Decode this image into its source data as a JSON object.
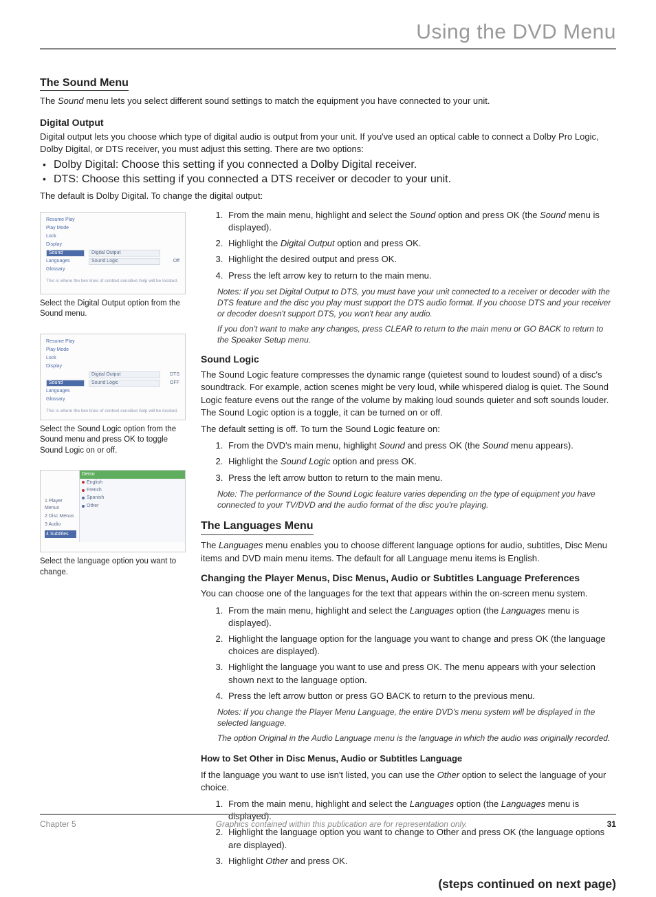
{
  "header": {
    "title": "Using the DVD Menu"
  },
  "sound_menu": {
    "heading": "The Sound Menu",
    "intro_pre": "The ",
    "intro_em": "Sound",
    "intro_post": " menu lets you select different sound settings to match the equipment you have connected to your unit."
  },
  "digital_output": {
    "heading": "Digital Output",
    "intro": "Digital output lets you choose which type of digital audio is output from your unit. If you've used an optical cable to connect a Dolby Pro Logic, Dolby Digital, or DTS receiver, you must adjust this setting. There are two options:",
    "bullets": [
      "Dolby Digital: Choose this setting if you connected a Dolby Digital receiver.",
      "DTS:  Choose this setting if you connected a DTS receiver or decoder to your unit."
    ],
    "default_line": "The default is Dolby Digital. To change the digital output:",
    "steps": [
      {
        "pre": "From the main menu, highlight and select the ",
        "em1": "Sound",
        "mid": " option and press OK (the ",
        "em2": "Sound",
        "post": " menu is displayed)."
      },
      {
        "pre": "Highlight the ",
        "em1": "Digital Output",
        "post": " option and press OK."
      },
      {
        "text": "Highlight the desired output and press OK."
      },
      {
        "text": "Press the left arrow key to return to the main menu."
      }
    ],
    "note1": "Notes: If you set Digital Output to DTS, you must have your unit connected to a receiver or decoder with the DTS feature and the disc you play must support the DTS audio format. If you choose DTS and your receiver or decoder doesn't support DTS, you won't hear any audio.",
    "note2": "If you don't want to make any changes, press CLEAR to return to the main menu or GO BACK to return to the Speaker Setup menu.",
    "caption": "Select the Digital Output option from the Sound menu.",
    "ss": {
      "items": [
        "Resume Play",
        "Play Mode",
        "Lock",
        "Display",
        "Sound",
        "Languages",
        "Glossary"
      ],
      "f1": "Digital Output",
      "f2": "Sound Logic",
      "v1": "",
      "v2": "Off",
      "help": "This is where the two lines of context sensitive help will be located."
    }
  },
  "sound_logic": {
    "heading": "Sound Logic",
    "intro": "The Sound Logic feature compresses the dynamic range (quietest sound to loudest sound) of a disc's soundtrack. For example, action scenes might be very loud, while whispered dialog is quiet. The Sound Logic feature evens out the range of the volume by making loud sounds quieter and soft sounds louder. The Sound Logic option is a toggle, it can be turned on or off.",
    "default_line": "The default setting is off. To turn the Sound Logic feature on:",
    "steps": [
      {
        "pre": "From the DVD's main menu, highlight ",
        "em1": "Sound",
        "mid": " and press OK (the ",
        "em2": "Sound",
        "post": " menu appears)."
      },
      {
        "pre": "Highlight the ",
        "em1": "Sound Logic",
        "post": " option and press OK."
      },
      {
        "text": "Press the left arrow button to return to the main menu."
      }
    ],
    "note1": "Note: The performance of the Sound Logic feature varies depending on the type of equipment you have connected to your TV/DVD and the audio format of the disc you're playing.",
    "caption": "Select the Sound Logic option from the Sound menu and press OK to toggle Sound Logic on or off.",
    "ss": {
      "f1": "Digital Output",
      "f2": "Sound Logic",
      "v1": "DTS",
      "v2": "OFF"
    }
  },
  "languages": {
    "heading": "The Languages Menu",
    "intro_pre": "The ",
    "intro_em": "Languages",
    "intro_post": " menu enables you to choose different language options for audio, subtitles, Disc Menu items and DVD main menu items. The default for all Language menu items is English.",
    "sub_heading": "Changing the Player Menus, Disc Menus, Audio or Subtitles Language Preferences",
    "choose_line": "You can choose one of the languages for the text that appears within the on-screen menu system.",
    "steps1": [
      {
        "pre": "From the main menu, highlight and select the ",
        "em1": "Languages",
        "mid": " option (the ",
        "em2": "Languages",
        "post": " menu is displayed)."
      },
      {
        "text": "Highlight the language option for the language you want to change and press OK (the language choices are displayed)."
      },
      {
        "text": "Highlight the language you want to use and press OK. The menu appears with your selection shown next to the language option."
      },
      {
        "text": "Press the left arrow button or press GO BACK to return to the previous menu."
      }
    ],
    "note1": "Notes: If you change the Player Menu Language, the entire DVD's menu system will be displayed in the selected language.",
    "note2": "The option Original in the Audio Language menu is the language in which the audio was originally recorded.",
    "how_other_heading": "How to Set Other in Disc Menus, Audio or Subtitles Language",
    "how_other_intro_pre": "If the language you want to use isn't listed, you can use the ",
    "how_other_intro_em": "Other",
    "how_other_intro_post": " option to select the language of your choice.",
    "steps2": [
      {
        "pre": "From the main menu, highlight and select the ",
        "em1": "Languages",
        "mid": " option (the ",
        "em2": "Languages",
        "post": " menu is displayed)."
      },
      {
        "text": "Highlight the language option you want to change to Other and press OK (the language options are displayed)."
      },
      {
        "pre": "Highlight ",
        "em1": "Other",
        "post": " and press OK."
      }
    ],
    "caption": "Select the language option you want to change.",
    "ss": {
      "left": [
        "1 Player Menus",
        "2 Disc Menus",
        "3 Audio",
        "4 Subtitles"
      ],
      "top_sel": "Demo",
      "opts": [
        "English",
        "French",
        "Spanish",
        "Other"
      ]
    }
  },
  "continued": "(steps continued on next page)",
  "footer": {
    "left": "Chapter 5",
    "center": "Graphics contained within this publication are for representation only.",
    "right": "31"
  }
}
